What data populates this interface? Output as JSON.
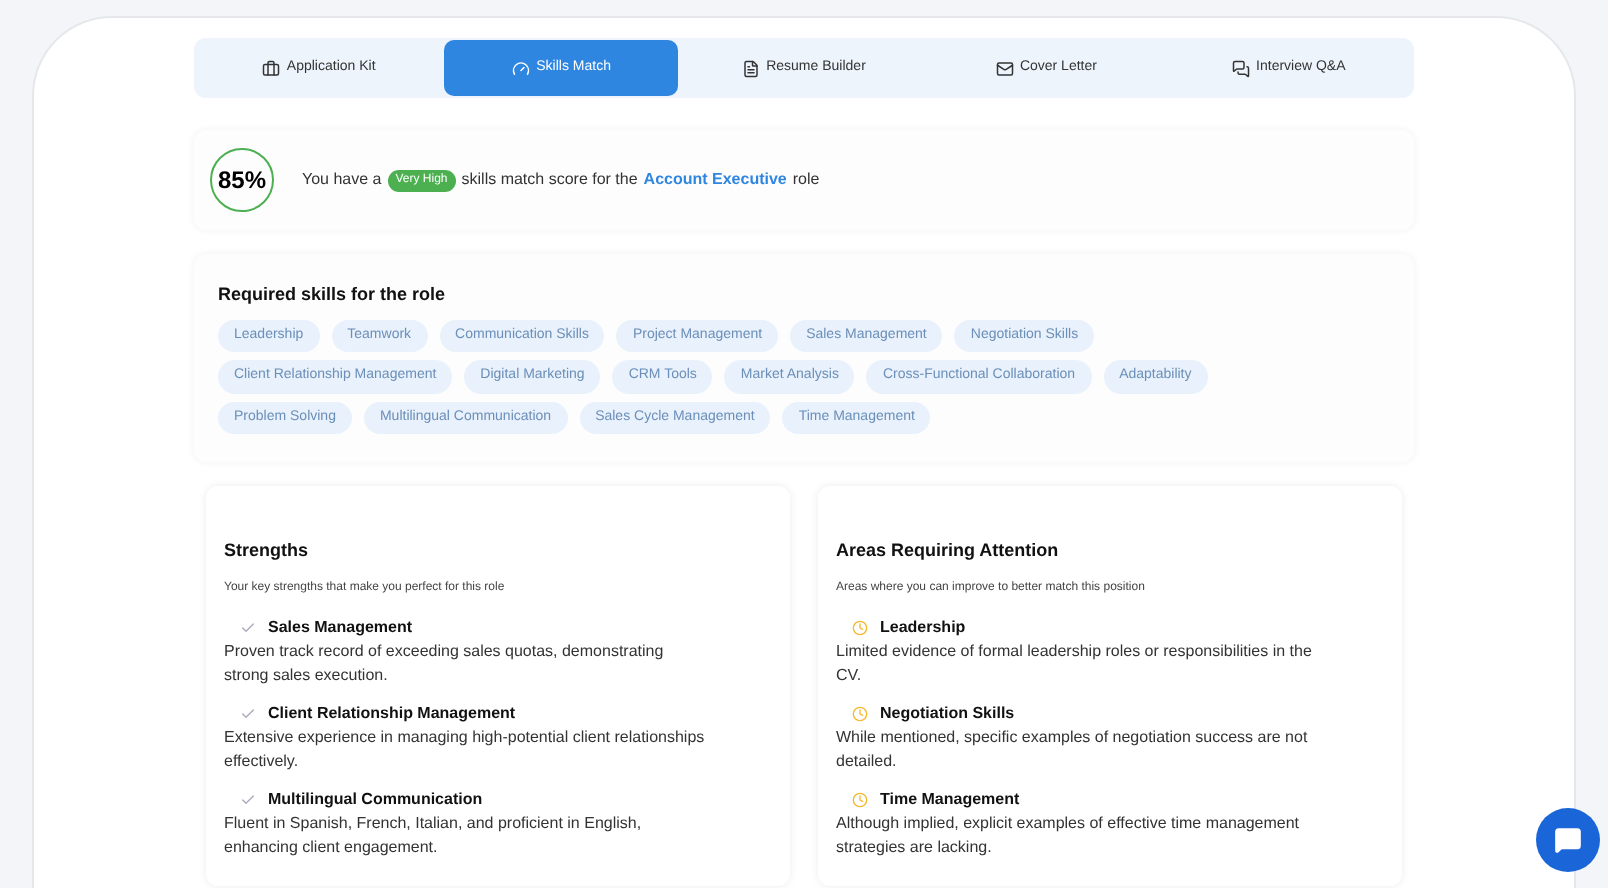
{
  "tabs": [
    {
      "label": "Application Kit",
      "selected": false
    },
    {
      "label": "Skills Match",
      "selected": true
    },
    {
      "label": "Resume Builder",
      "selected": false
    },
    {
      "label": "Cover Letter",
      "selected": false
    },
    {
      "label": "Interview Q&A",
      "selected": false
    }
  ],
  "score": {
    "percent": "85%",
    "text_before": "You have a",
    "badge": "Very High",
    "text_middle": "skills match score for the",
    "role": "Account Executive",
    "text_after": "role"
  },
  "required_skills": {
    "title": "Required skills for the role",
    "skills": [
      "Leadership",
      "Teamwork",
      "Communication Skills",
      "Project Management",
      "Sales Management",
      "Negotiation Skills",
      "Client Relationship Management",
      "Digital Marketing",
      "CRM Tools",
      "Market Analysis",
      "Cross-Functional Collaboration",
      "Adaptability",
      "Problem Solving",
      "Multilingual Communication",
      "Sales Cycle Management",
      "Time Management"
    ]
  },
  "panels": [
    {
      "kind": "strength",
      "title": "Strengths",
      "subtitle": "Your key strengths that make you perfect for this role",
      "items": [
        {
          "name": "Sales Management",
          "detail": "Proven track record of exceeding sales quotas, demonstrating strong sales execution."
        },
        {
          "name": "Client Relationship Management",
          "detail": "Extensive experience in managing high-potential client relationships effectively."
        },
        {
          "name": "Multilingual Communication",
          "detail": "Fluent in Spanish, French, Italian, and proficient in English, enhancing client engagement."
        }
      ]
    },
    {
      "kind": "attention",
      "title": "Areas Requiring Attention",
      "subtitle": "Areas where you can improve to better match this position",
      "items": [
        {
          "name": "Leadership",
          "detail": "Limited evidence of formal leadership roles or responsibilities in the CV."
        },
        {
          "name": "Negotiation Skills",
          "detail": "While mentioned, specific examples of negotiation success are not detailed."
        },
        {
          "name": "Time Management",
          "detail": "Although implied, explicit examples of effective time management strategies are lacking."
        }
      ]
    }
  ]
}
